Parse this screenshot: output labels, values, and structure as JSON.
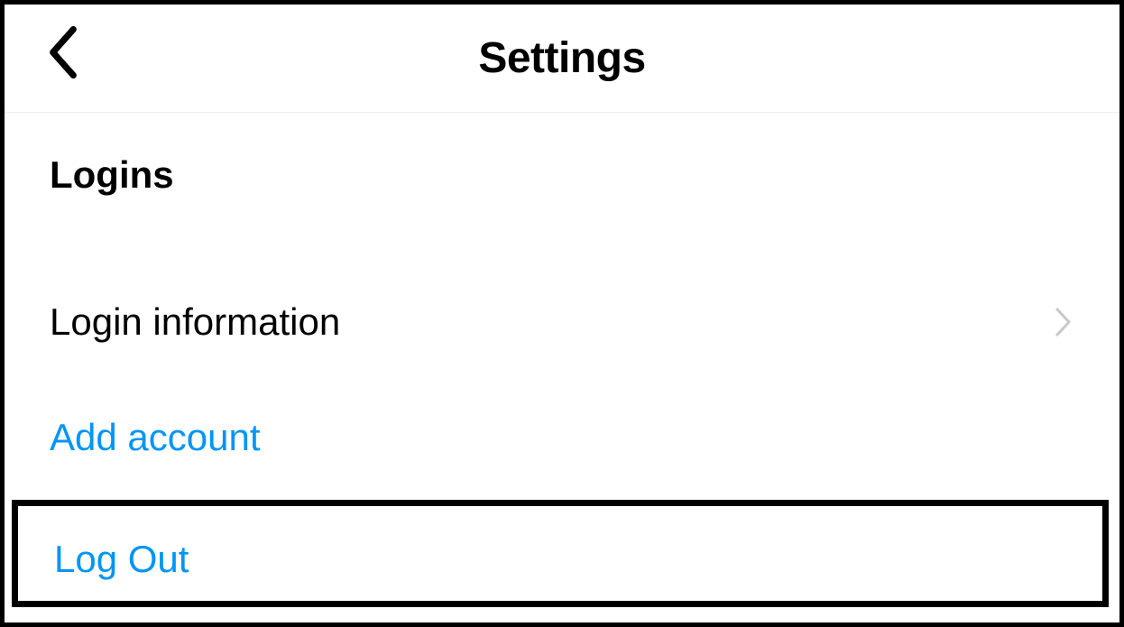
{
  "header": {
    "title": "Settings"
  },
  "section": {
    "title": "Logins"
  },
  "items": {
    "login_info": "Login information",
    "add_account": "Add account",
    "log_out": "Log Out"
  }
}
